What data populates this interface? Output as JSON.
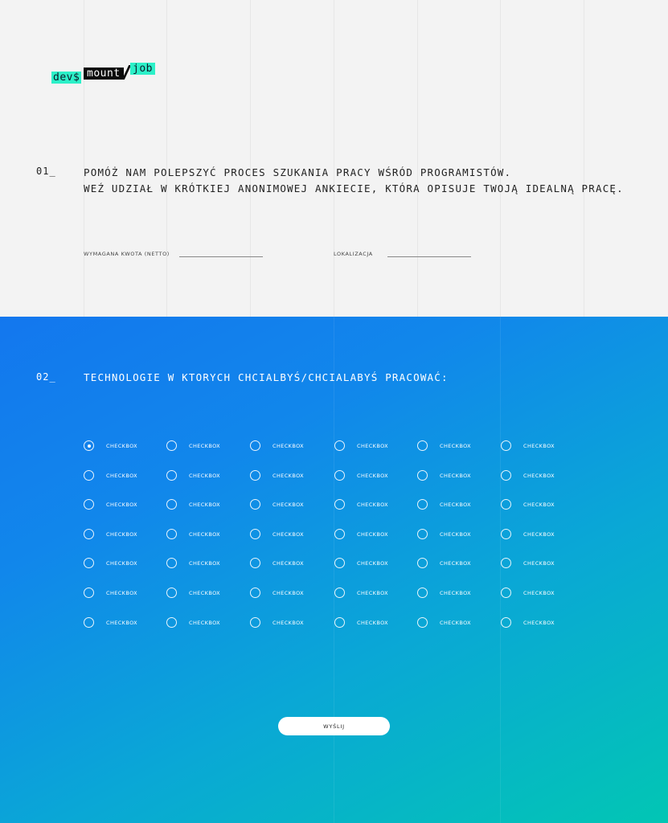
{
  "logo": {
    "part1": "dev$",
    "part2": "mount",
    "part3": "job"
  },
  "section1": {
    "number": "01_",
    "line1": "POMÓŻ NAM POLEPSZYĆ PROCES SZUKANIA PRACY WŚRÓD PROGRAMISTÓW.",
    "line2": "WEŹ UDZIAŁ W KRÓTKIEJ ANONIMOWEJ ANKIECIE, KTÓRA OPISUJE TWOJĄ IDEALNĄ PRACĘ.",
    "salary_label": "WYMAGANA KWOTA (NETTO)",
    "salary_value": "",
    "location_label": "LOKALIZACJA",
    "location_value": ""
  },
  "section2": {
    "number": "02_",
    "title": "TECHNOLOGIE W KTORYCH CHCIALBYŚ/CHCIALABYŚ PRACOWAĆ:",
    "rows": 7,
    "cols": 6,
    "checkbox_label": "CHECKBOX",
    "checked": [
      [
        0,
        0
      ]
    ],
    "submit_label": "WYŚLIJ"
  },
  "colors": {
    "accent_green": "#2cf0c8",
    "gradient_start": "#1377ee",
    "gradient_end": "#02c6b4",
    "page_bg": "#f3f3f3"
  }
}
